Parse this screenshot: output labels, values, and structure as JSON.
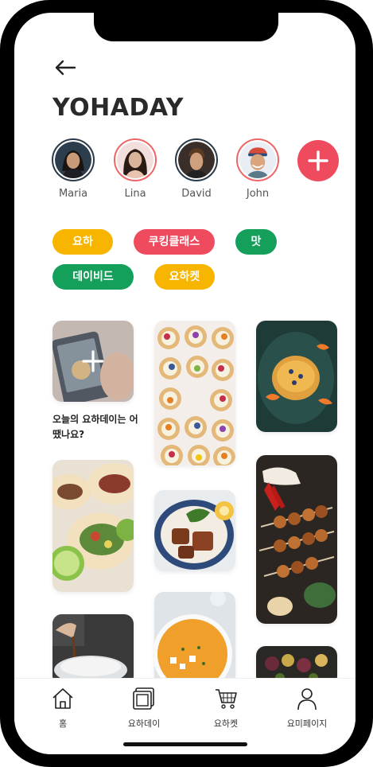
{
  "app": {
    "title": "YOHADAY"
  },
  "header": {
    "back_icon": "arrow-left-icon"
  },
  "stories": [
    {
      "name": "Maria"
    },
    {
      "name": "Lina"
    },
    {
      "name": "David"
    },
    {
      "name": "John"
    }
  ],
  "add_story": {
    "icon": "plus-icon"
  },
  "tags": [
    {
      "label": "요하",
      "color": "#f7b500"
    },
    {
      "label": "쿠킹클래스",
      "color": "#ef4b5f"
    },
    {
      "label": "맛",
      "color": "#14a05a"
    },
    {
      "label": "데이비드",
      "color": "#14a05a"
    },
    {
      "label": "요하켓",
      "color": "#f7b500"
    }
  ],
  "feed": {
    "prompt_text": "오늘의 요하데이는 어땠나요?"
  },
  "tabbar": {
    "tabs": [
      {
        "label": "홈",
        "icon": "home-icon"
      },
      {
        "label": "요하데이",
        "icon": "photo-stack-icon"
      },
      {
        "label": "요하켓",
        "icon": "cart-icon"
      },
      {
        "label": "요미페이지",
        "icon": "person-icon"
      }
    ]
  },
  "colors": {
    "accent": "#ef4b5f",
    "yellow": "#f7b500",
    "green": "#14a05a"
  }
}
